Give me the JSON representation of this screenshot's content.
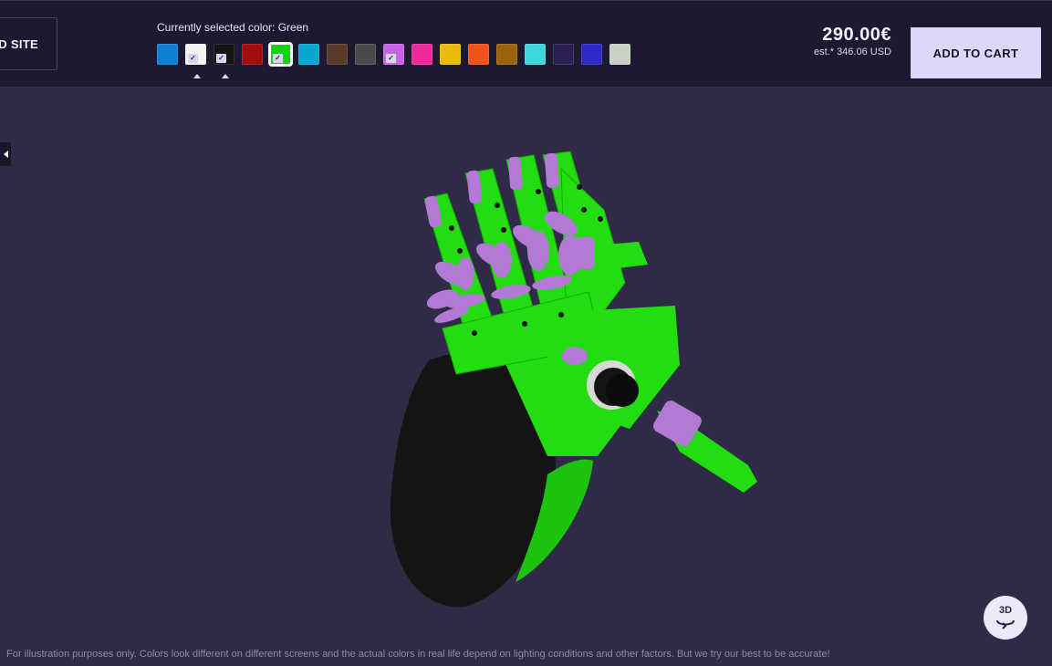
{
  "header": {
    "back_label": "D SITE",
    "selected_color_text": "Currently selected color: Green",
    "price": "290.00€",
    "usd_estimate": "est.* 346.06 USD",
    "cart_label": "ADD TO CART"
  },
  "swatches": [
    {
      "name": "blue",
      "color": "#0e7fd4",
      "checked": false,
      "selected": false
    },
    {
      "name": "white",
      "color": "#f2f2f2",
      "checked": true,
      "selected": false
    },
    {
      "name": "black",
      "color": "#151515",
      "checked": true,
      "selected": false
    },
    {
      "name": "dark-red",
      "color": "#a30d0d",
      "checked": false,
      "selected": false
    },
    {
      "name": "green",
      "color": "#12d212",
      "checked": true,
      "selected": true
    },
    {
      "name": "cyan-blue",
      "color": "#09a7cf",
      "checked": false,
      "selected": false
    },
    {
      "name": "brown-speckled",
      "color": "#5a3a2a",
      "checked": false,
      "selected": false
    },
    {
      "name": "dark-gray",
      "color": "#4a4a4a",
      "checked": false,
      "selected": false
    },
    {
      "name": "lilac",
      "color": "#c565e6",
      "checked": true,
      "selected": false
    },
    {
      "name": "pink",
      "color": "#f2289d",
      "checked": false,
      "selected": false
    },
    {
      "name": "yellow",
      "color": "#e9b90b",
      "checked": false,
      "selected": false
    },
    {
      "name": "orange",
      "color": "#f2531c",
      "checked": false,
      "selected": false
    },
    {
      "name": "ochre",
      "color": "#9a6408",
      "checked": false,
      "selected": false
    },
    {
      "name": "turquoise",
      "color": "#3ed6d9",
      "checked": false,
      "selected": false
    },
    {
      "name": "galaxy",
      "color": "#2b1f52",
      "checked": false,
      "selected": false
    },
    {
      "name": "glow",
      "color": "#2e28c9",
      "checked": false,
      "selected": false
    },
    {
      "name": "silk",
      "color": "#c9d2c4",
      "checked": false,
      "selected": false
    }
  ],
  "viewer": {
    "badge_text": "3D",
    "disclaimer": "For illustration purposes only. Colors look different on different screens and the actual colors in real life depend on lighting conditions and other factors. But we try our best to be accurate!"
  },
  "colors": {
    "background": "#2f2a45",
    "topbar": "#1d1930",
    "cart_button": "#dcd6f7",
    "model_green": "#22dd10",
    "model_lilac": "#b27ad4",
    "model_black": "#141414"
  }
}
